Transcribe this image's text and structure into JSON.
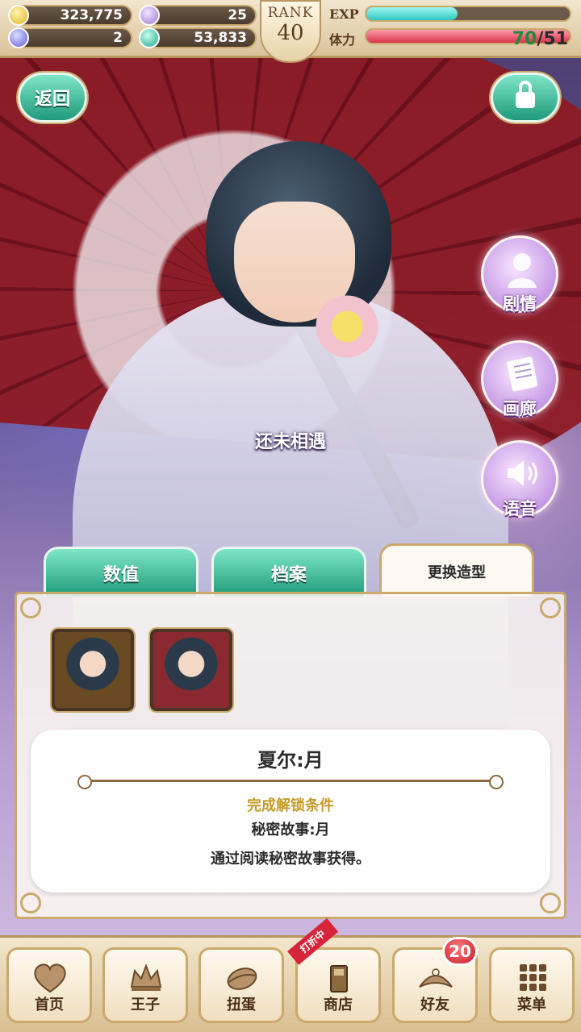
{
  "status_bar": {
    "gold": "323,775",
    "feather": "25",
    "gem": "2",
    "orb": "53,833",
    "rank_label": "RANK",
    "rank_value": "40",
    "exp_label": "EXP",
    "exp_fill": 0.45,
    "stamina_label": "体力",
    "stamina_current": "70",
    "stamina_max": "/51",
    "stamina_fill": 1.0
  },
  "top_buttons": {
    "back_label": "返回"
  },
  "side_buttons": [
    {
      "label": "剧情"
    },
    {
      "label": "画廊"
    },
    {
      "label": "语音"
    }
  ],
  "scene": {
    "status_text": "还未相遇"
  },
  "tabs": [
    {
      "label": "数值"
    },
    {
      "label": "档案"
    },
    {
      "label": "更换造型"
    }
  ],
  "outfit_detail": {
    "title": "夏尔:月",
    "condition_title": "完成解锁条件",
    "condition_name": "秘密故事:月",
    "condition_desc": "通过阅读秘密故事获得。"
  },
  "bottom_nav": {
    "items": [
      {
        "label": "首页",
        "icon": "heart-icon"
      },
      {
        "label": "王子",
        "icon": "crown-icon"
      },
      {
        "label": "扭蛋",
        "icon": "capsule-icon"
      },
      {
        "label": "商店",
        "icon": "shop-icon"
      },
      {
        "label": "好友",
        "icon": "tiara-icon"
      },
      {
        "label": "菜单",
        "icon": "grid-icon"
      }
    ],
    "sale_ribbon": "打折中",
    "friend_badge": "20"
  },
  "colors": {
    "accent_green": "#1f9a7a",
    "gold_border": "#c9a96c",
    "condition_gold": "#c69a2a"
  }
}
